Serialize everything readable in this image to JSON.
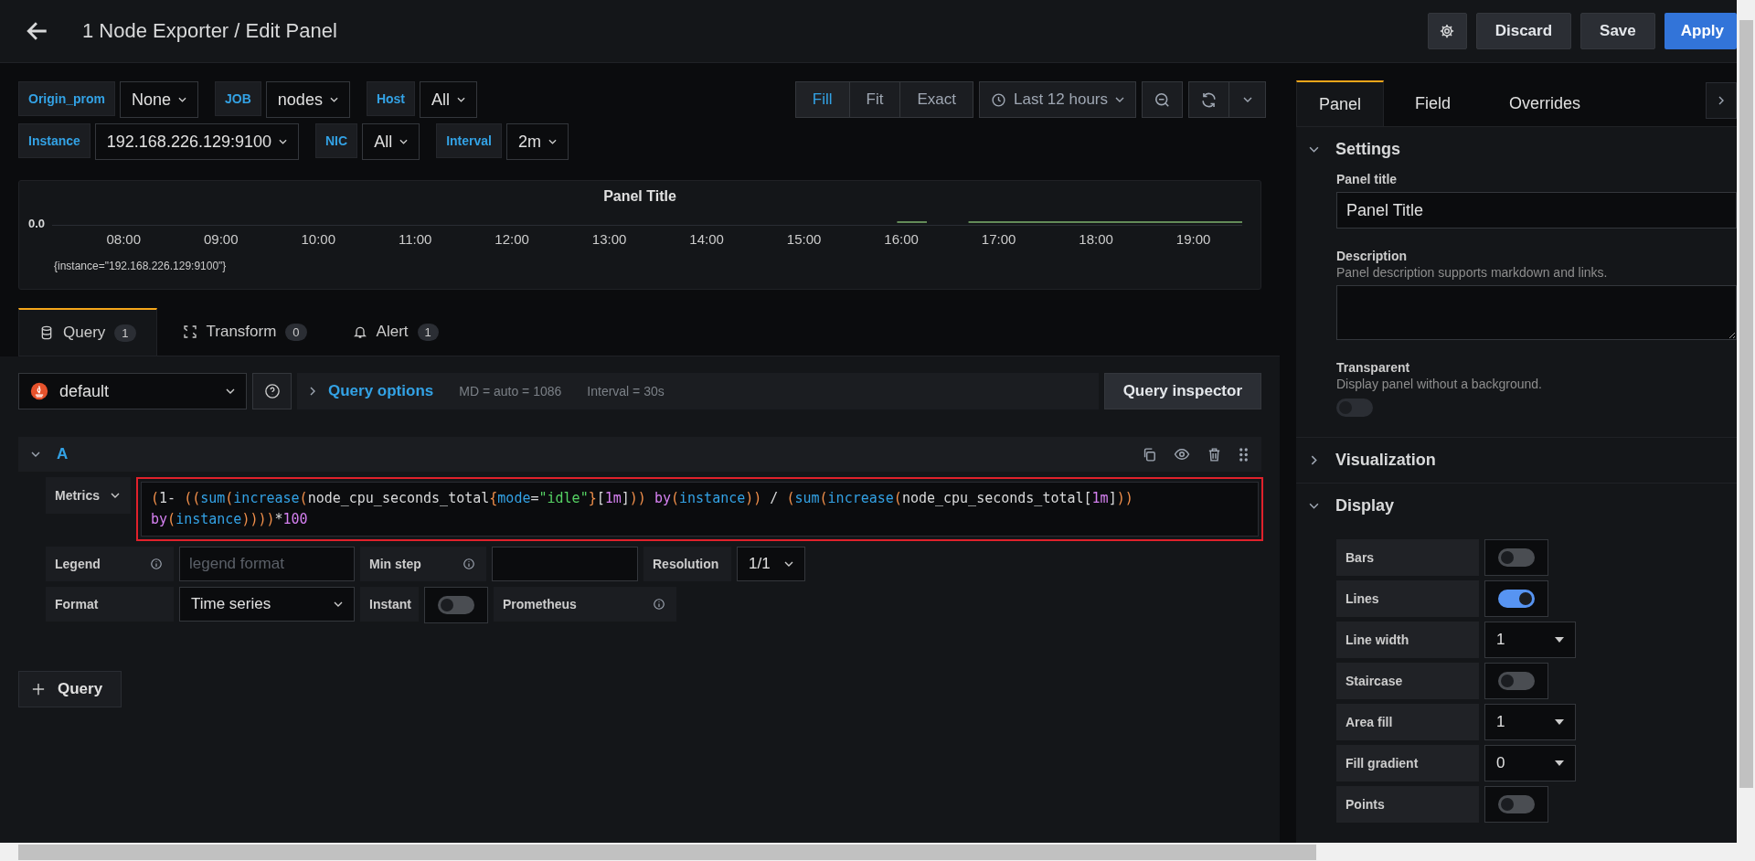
{
  "header": {
    "title": "1 Node Exporter / Edit Panel",
    "buttons": [
      {
        "label": "Discard",
        "kind": "secondary"
      },
      {
        "label": "Save",
        "kind": "secondary"
      },
      {
        "label": "Apply",
        "kind": "primary"
      }
    ]
  },
  "variables": [
    [
      {
        "label": "Origin_prom",
        "value": "None"
      },
      {
        "label": "JOB",
        "value": "nodes"
      },
      {
        "label": "Host",
        "value": "All"
      }
    ],
    [
      {
        "label": "Instance",
        "value": "192.168.226.129:9100"
      },
      {
        "label": "NIC",
        "value": "All"
      },
      {
        "label": "Interval",
        "value": "2m"
      }
    ]
  ],
  "zoom_modes": [
    {
      "label": "Fill",
      "selected": true
    },
    {
      "label": "Fit",
      "selected": false
    },
    {
      "label": "Exact",
      "selected": false
    }
  ],
  "time_range": "Last 12 hours",
  "panel": {
    "title": "Panel Title",
    "y_tick": "0.0",
    "x_ticks": [
      "08:00",
      "09:00",
      "10:00",
      "11:00",
      "12:00",
      "13:00",
      "14:00",
      "15:00",
      "16:00",
      "17:00",
      "18:00",
      "19:00"
    ],
    "legend": "{instance=\"192.168.226.129:9100\"}"
  },
  "query_tabs": [
    {
      "label": "Query",
      "count": "1",
      "selected": true
    },
    {
      "label": "Transform",
      "count": "0",
      "selected": false
    },
    {
      "label": "Alert",
      "count": "1",
      "selected": false
    }
  ],
  "datasource": "default",
  "query_options": {
    "label": "Query options",
    "md": "MD = auto = 1086",
    "interval": "Interval = 30s"
  },
  "inspector_button": "Query inspector",
  "query": {
    "ref": "A",
    "metrics_label": "Metrics",
    "lines": [
      [
        {
          "text": "(",
          "kind": "paren"
        },
        {
          "text": "1- ",
          "kind": "plain"
        },
        {
          "text": "((",
          "kind": "paren"
        },
        {
          "text": "sum",
          "kind": "func"
        },
        {
          "text": "(",
          "kind": "paren"
        },
        {
          "text": "increase",
          "kind": "func"
        },
        {
          "text": "(",
          "kind": "paren"
        },
        {
          "text": "node_cpu_seconds_total",
          "kind": "plain"
        },
        {
          "text": "{",
          "kind": "paren"
        },
        {
          "text": "mode",
          "kind": "func"
        },
        {
          "text": "=",
          "kind": "plain"
        },
        {
          "text": "\"idle\"",
          "kind": "string"
        },
        {
          "text": "}",
          "kind": "paren"
        },
        {
          "text": "[",
          "kind": "plain"
        },
        {
          "text": "1m",
          "kind": "number"
        },
        {
          "text": "]",
          "kind": "plain"
        },
        {
          "text": "))",
          "kind": "paren"
        },
        {
          "text": " by",
          "kind": "number"
        },
        {
          "text": "(",
          "kind": "paren"
        },
        {
          "text": "instance",
          "kind": "func"
        },
        {
          "text": "))",
          "kind": "paren"
        },
        {
          "text": " / ",
          "kind": "plain"
        },
        {
          "text": "(",
          "kind": "paren"
        },
        {
          "text": "sum",
          "kind": "func"
        },
        {
          "text": "(",
          "kind": "paren"
        },
        {
          "text": "increase",
          "kind": "func"
        },
        {
          "text": "(",
          "kind": "paren"
        },
        {
          "text": "node_cpu_seconds_total",
          "kind": "plain"
        },
        {
          "text": "[",
          "kind": "plain"
        },
        {
          "text": "1m",
          "kind": "number"
        },
        {
          "text": "]",
          "kind": "plain"
        },
        {
          "text": "))",
          "kind": "paren"
        }
      ],
      [
        {
          "text": "by",
          "kind": "number"
        },
        {
          "text": "(",
          "kind": "paren"
        },
        {
          "text": "instance",
          "kind": "func"
        },
        {
          "text": "))))",
          "kind": "paren"
        },
        {
          "text": "*",
          "kind": "plain"
        },
        {
          "text": "100",
          "kind": "number"
        }
      ]
    ],
    "legend_label": "Legend",
    "legend_placeholder": "legend format",
    "min_step_label": "Min step",
    "resolution_label": "Resolution",
    "resolution": "1/1",
    "format_label": "Format",
    "format": "Time series",
    "instant_label": "Instant",
    "instant_on": false,
    "source": "Prometheus"
  },
  "add_query": "Query",
  "options_tabs": [
    {
      "label": "Panel",
      "selected": true
    },
    {
      "label": "Field",
      "selected": false
    },
    {
      "label": "Overrides",
      "selected": false
    }
  ],
  "settings": {
    "title": "Settings",
    "expanded": true,
    "panel_title_label": "Panel title",
    "panel_title": "Panel Title",
    "description_label": "Description",
    "description_hint": "Panel description supports markdown and links.",
    "transparent_label": "Transparent",
    "transparent_hint": "Display panel without a background.",
    "transparent_on": false
  },
  "visualization": {
    "title": "Visualization",
    "expanded": false
  },
  "display": {
    "title": "Display",
    "expanded": true,
    "rows": [
      {
        "label": "Bars",
        "kind": "switch",
        "on": false
      },
      {
        "label": "Lines",
        "kind": "switch",
        "on": true
      },
      {
        "label": "Line width",
        "kind": "select",
        "value": "1"
      },
      {
        "label": "Staircase",
        "kind": "switch",
        "on": false
      },
      {
        "label": "Area fill",
        "kind": "select",
        "value": "1"
      },
      {
        "label": "Fill gradient",
        "kind": "select",
        "value": "0"
      },
      {
        "label": "Points",
        "kind": "switch",
        "on": false
      }
    ]
  }
}
